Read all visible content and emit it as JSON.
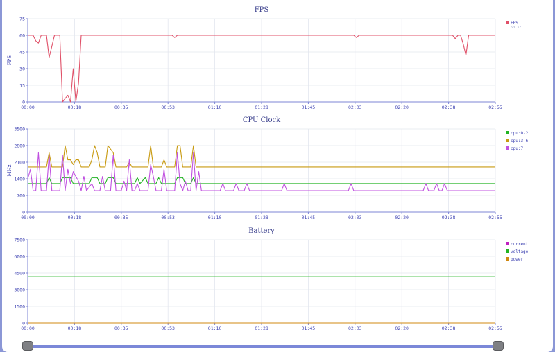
{
  "chart_data": [
    {
      "type": "line",
      "title": "FPS",
      "ylabel": "FPS",
      "ylim": [
        0,
        75
      ],
      "yticks": [
        0,
        15,
        30,
        45,
        60,
        75
      ],
      "xlim": [
        0,
        175
      ],
      "xticks": [
        "00:00",
        "00:18",
        "00:35",
        "00:53",
        "01:10",
        "01:28",
        "01:45",
        "02:03",
        "02:20",
        "02:38",
        "02:55"
      ],
      "legend": [
        {
          "name": "FPS",
          "sub": "60.32",
          "color": "#e05068"
        }
      ],
      "series": [
        {
          "name": "FPS",
          "color": "#e05068",
          "points": [
            [
              0,
              60
            ],
            [
              2,
              60
            ],
            [
              3,
              55
            ],
            [
              4,
              53
            ],
            [
              5,
              60
            ],
            [
              7,
              60
            ],
            [
              8,
              40
            ],
            [
              9,
              50
            ],
            [
              10,
              60
            ],
            [
              12,
              60
            ],
            [
              13,
              0
            ],
            [
              14,
              3
            ],
            [
              15,
              6
            ],
            [
              16,
              0
            ],
            [
              17,
              30
            ],
            [
              18,
              0
            ],
            [
              19,
              17
            ],
            [
              20,
              60
            ],
            [
              54,
              60
            ],
            [
              55,
              58
            ],
            [
              56,
              60
            ],
            [
              122,
              60
            ],
            [
              123,
              58
            ],
            [
              124,
              60
            ],
            [
              159,
              60
            ],
            [
              160,
              57
            ],
            [
              161,
              60
            ],
            [
              162,
              60
            ],
            [
              163,
              52
            ],
            [
              164,
              42
            ],
            [
              165,
              60
            ],
            [
              175,
              60
            ]
          ]
        }
      ]
    },
    {
      "type": "line",
      "title": "CPU Clock",
      "ylabel": "MHz",
      "ylim": [
        0,
        3500
      ],
      "yticks": [
        0,
        700,
        1400,
        2100,
        2800,
        3500
      ],
      "xlim": [
        0,
        175
      ],
      "xticks": [
        "00:00",
        "00:18",
        "00:35",
        "00:53",
        "01:10",
        "01:28",
        "01:45",
        "02:03",
        "02:20",
        "02:38",
        "02:55"
      ],
      "legend": [
        {
          "name": "cpu:0-2",
          "color": "#22b422"
        },
        {
          "name": "cpu:3-6",
          "color": "#c89a10"
        },
        {
          "name": "cpu:7",
          "color": "#c050e0"
        }
      ],
      "series": [
        {
          "name": "cpu:0-2",
          "color": "#22b422",
          "points": [
            [
              0,
              1200
            ],
            [
              7,
              1200
            ],
            [
              8,
              1450
            ],
            [
              9,
              1200
            ],
            [
              12,
              1200
            ],
            [
              13,
              1450
            ],
            [
              16,
              1450
            ],
            [
              17,
              1200
            ],
            [
              23,
              1200
            ],
            [
              24,
              1450
            ],
            [
              26,
              1450
            ],
            [
              27,
              1200
            ],
            [
              29,
              1200
            ],
            [
              30,
              1450
            ],
            [
              32,
              1450
            ],
            [
              33,
              1200
            ],
            [
              40,
              1200
            ],
            [
              41,
              1450
            ],
            [
              42,
              1200
            ],
            [
              44,
              1450
            ],
            [
              45,
              1200
            ],
            [
              48,
              1200
            ],
            [
              49,
              1450
            ],
            [
              50,
              1200
            ],
            [
              55,
              1200
            ],
            [
              56,
              1450
            ],
            [
              58,
              1450
            ],
            [
              59,
              1200
            ],
            [
              61,
              1200
            ],
            [
              62,
              1450
            ],
            [
              63,
              1200
            ],
            [
              175,
              1200
            ]
          ]
        },
        {
          "name": "cpu:3-6",
          "color": "#c89a10",
          "points": [
            [
              0,
              1900
            ],
            [
              7,
              1900
            ],
            [
              8,
              2500
            ],
            [
              9,
              1900
            ],
            [
              13,
              1900
            ],
            [
              14,
              2800
            ],
            [
              15,
              2200
            ],
            [
              16,
              2200
            ],
            [
              17,
              2000
            ],
            [
              18,
              2200
            ],
            [
              19,
              2200
            ],
            [
              20,
              1900
            ],
            [
              23,
              1900
            ],
            [
              24,
              2200
            ],
            [
              25,
              2800
            ],
            [
              26,
              2500
            ],
            [
              27,
              1900
            ],
            [
              29,
              1900
            ],
            [
              30,
              2800
            ],
            [
              32,
              2500
            ],
            [
              33,
              1900
            ],
            [
              37,
              1900
            ],
            [
              38,
              2100
            ],
            [
              39,
              1900
            ],
            [
              45,
              1900
            ],
            [
              46,
              2800
            ],
            [
              47,
              1900
            ],
            [
              50,
              1900
            ],
            [
              51,
              2200
            ],
            [
              52,
              1900
            ],
            [
              55,
              1900
            ],
            [
              56,
              2800
            ],
            [
              57,
              2800
            ],
            [
              58,
              1900
            ],
            [
              61,
              1900
            ],
            [
              62,
              2800
            ],
            [
              63,
              1900
            ],
            [
              175,
              1900
            ]
          ]
        },
        {
          "name": "cpu:7",
          "color": "#c050e0",
          "points": [
            [
              0,
              1400
            ],
            [
              1,
              1800
            ],
            [
              2,
              900
            ],
            [
              3,
              900
            ],
            [
              4,
              2500
            ],
            [
              5,
              900
            ],
            [
              7,
              900
            ],
            [
              8,
              2400
            ],
            [
              9,
              900
            ],
            [
              12,
              900
            ],
            [
              13,
              2400
            ],
            [
              14,
              900
            ],
            [
              15,
              1800
            ],
            [
              16,
              1200
            ],
            [
              17,
              1700
            ],
            [
              18,
              1500
            ],
            [
              19,
              1300
            ],
            [
              20,
              900
            ],
            [
              21,
              1500
            ],
            [
              22,
              900
            ],
            [
              24,
              1200
            ],
            [
              25,
              900
            ],
            [
              27,
              900
            ],
            [
              28,
              1500
            ],
            [
              29,
              900
            ],
            [
              31,
              900
            ],
            [
              32,
              2400
            ],
            [
              33,
              900
            ],
            [
              35,
              900
            ],
            [
              36,
              1300
            ],
            [
              37,
              900
            ],
            [
              38,
              2200
            ],
            [
              39,
              900
            ],
            [
              40,
              900
            ],
            [
              41,
              1200
            ],
            [
              42,
              900
            ],
            [
              45,
              900
            ],
            [
              46,
              2000
            ],
            [
              47,
              1500
            ],
            [
              48,
              900
            ],
            [
              50,
              900
            ],
            [
              51,
              1800
            ],
            [
              52,
              900
            ],
            [
              55,
              900
            ],
            [
              56,
              2500
            ],
            [
              57,
              1200
            ],
            [
              58,
              900
            ],
            [
              59,
              1300
            ],
            [
              60,
              900
            ],
            [
              61,
              900
            ],
            [
              62,
              2500
            ],
            [
              63,
              900
            ],
            [
              64,
              1700
            ],
            [
              65,
              900
            ],
            [
              72,
              900
            ],
            [
              73,
              1200
            ],
            [
              74,
              900
            ],
            [
              77,
              900
            ],
            [
              78,
              1200
            ],
            [
              79,
              900
            ],
            [
              81,
              900
            ],
            [
              82,
              1200
            ],
            [
              83,
              900
            ],
            [
              95,
              900
            ],
            [
              96,
              1200
            ],
            [
              97,
              900
            ],
            [
              120,
              900
            ],
            [
              121,
              1200
            ],
            [
              122,
              900
            ],
            [
              148,
              900
            ],
            [
              149,
              1200
            ],
            [
              150,
              900
            ],
            [
              152,
              900
            ],
            [
              153,
              1200
            ],
            [
              154,
              900
            ],
            [
              155,
              900
            ],
            [
              156,
              1200
            ],
            [
              157,
              900
            ],
            [
              175,
              900
            ]
          ]
        }
      ]
    },
    {
      "type": "line",
      "title": "Battery",
      "ylabel": "",
      "ylim": [
        0,
        7500
      ],
      "yticks": [
        0,
        1500,
        3000,
        4500,
        6000,
        7500
      ],
      "xlim": [
        0,
        175
      ],
      "xticks": [
        "00:00",
        "00:18",
        "00:35",
        "00:53",
        "01:10",
        "01:28",
        "01:45",
        "02:03",
        "02:20",
        "02:38",
        "02:55"
      ],
      "legend": [
        {
          "name": "current",
          "color": "#c020c0"
        },
        {
          "name": "voltage",
          "color": "#22b422"
        },
        {
          "name": "power",
          "color": "#d08810"
        }
      ],
      "series": [
        {
          "name": "voltage",
          "color": "#22b422",
          "points": [
            [
              0,
              4200
            ],
            [
              175,
              4200
            ]
          ]
        },
        {
          "name": "current",
          "color": "#c020c0",
          "points": [
            [
              0,
              0
            ],
            [
              175,
              0
            ]
          ]
        },
        {
          "name": "power",
          "color": "#d08810",
          "points": [
            [
              0,
              0
            ],
            [
              175,
              0
            ]
          ]
        }
      ]
    }
  ],
  "colors": {
    "page_background": "#8b97d6",
    "axis": "#7d86d6",
    "slider_track": "#7b88d8",
    "slider_handle": "#7f8084"
  },
  "slider": {
    "start": 0,
    "end": 1
  }
}
